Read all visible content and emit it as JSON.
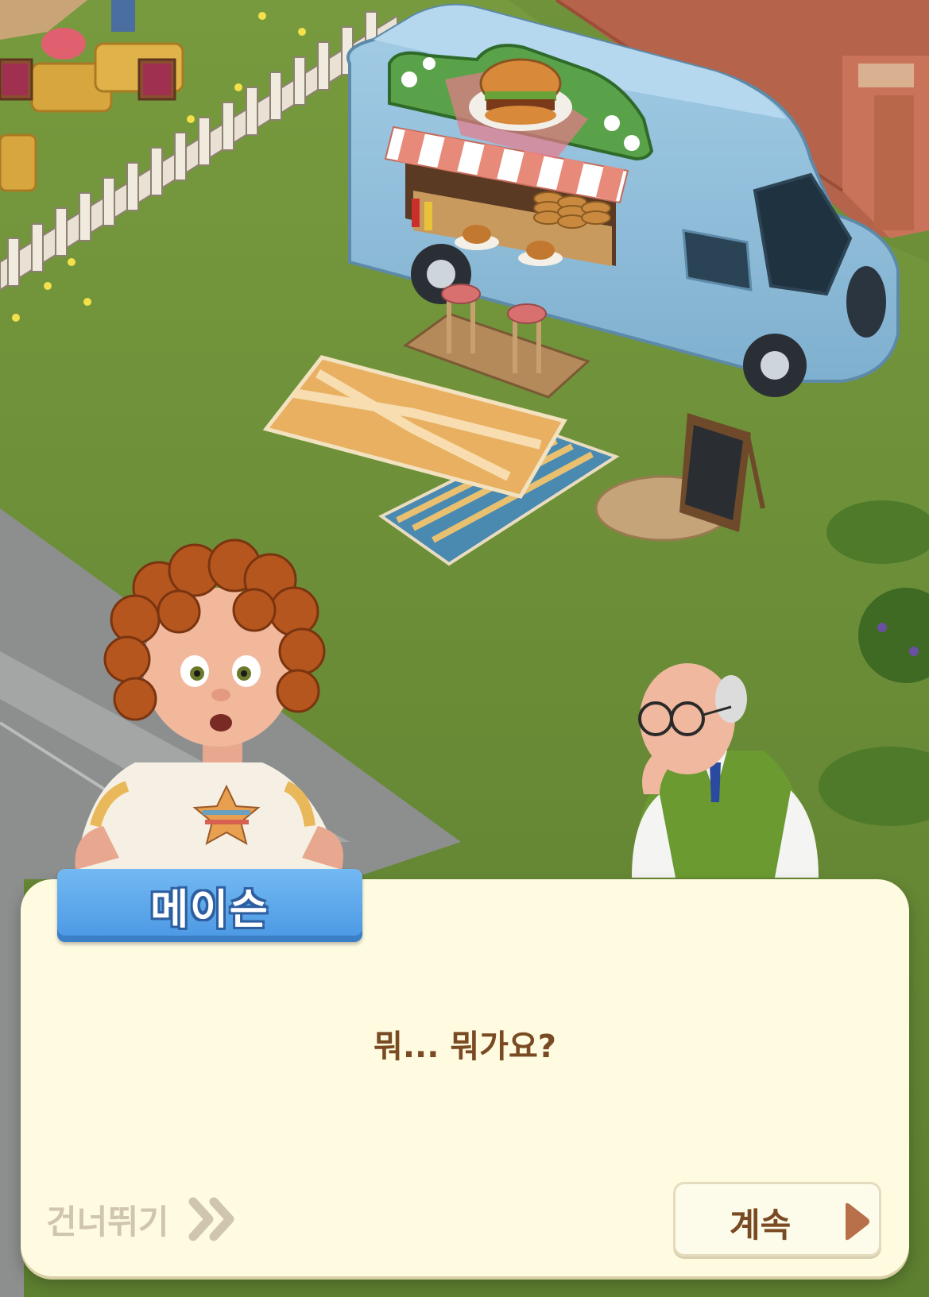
{
  "scene": {
    "description_icons": [
      "food-truck",
      "bagel-sign",
      "chalkboard-menu",
      "rug",
      "stool",
      "hay-bale",
      "fence",
      "boy-character",
      "old-man-character"
    ],
    "colors": {
      "grass": "#6b8e3a",
      "truck": "#8fbfdc",
      "dialog_bg": "#fefbe1",
      "name_tag": "#4a97e3",
      "text_brown": "#7a4a22"
    }
  },
  "dialog": {
    "speaker_name": "메이슨",
    "text": "뭐... 뭐가요?"
  },
  "controls": {
    "skip_label": "건너뛰기",
    "continue_label": "계속",
    "skip_icon": "double-chevron-right-icon",
    "continue_icon": "play-triangle-icon"
  }
}
